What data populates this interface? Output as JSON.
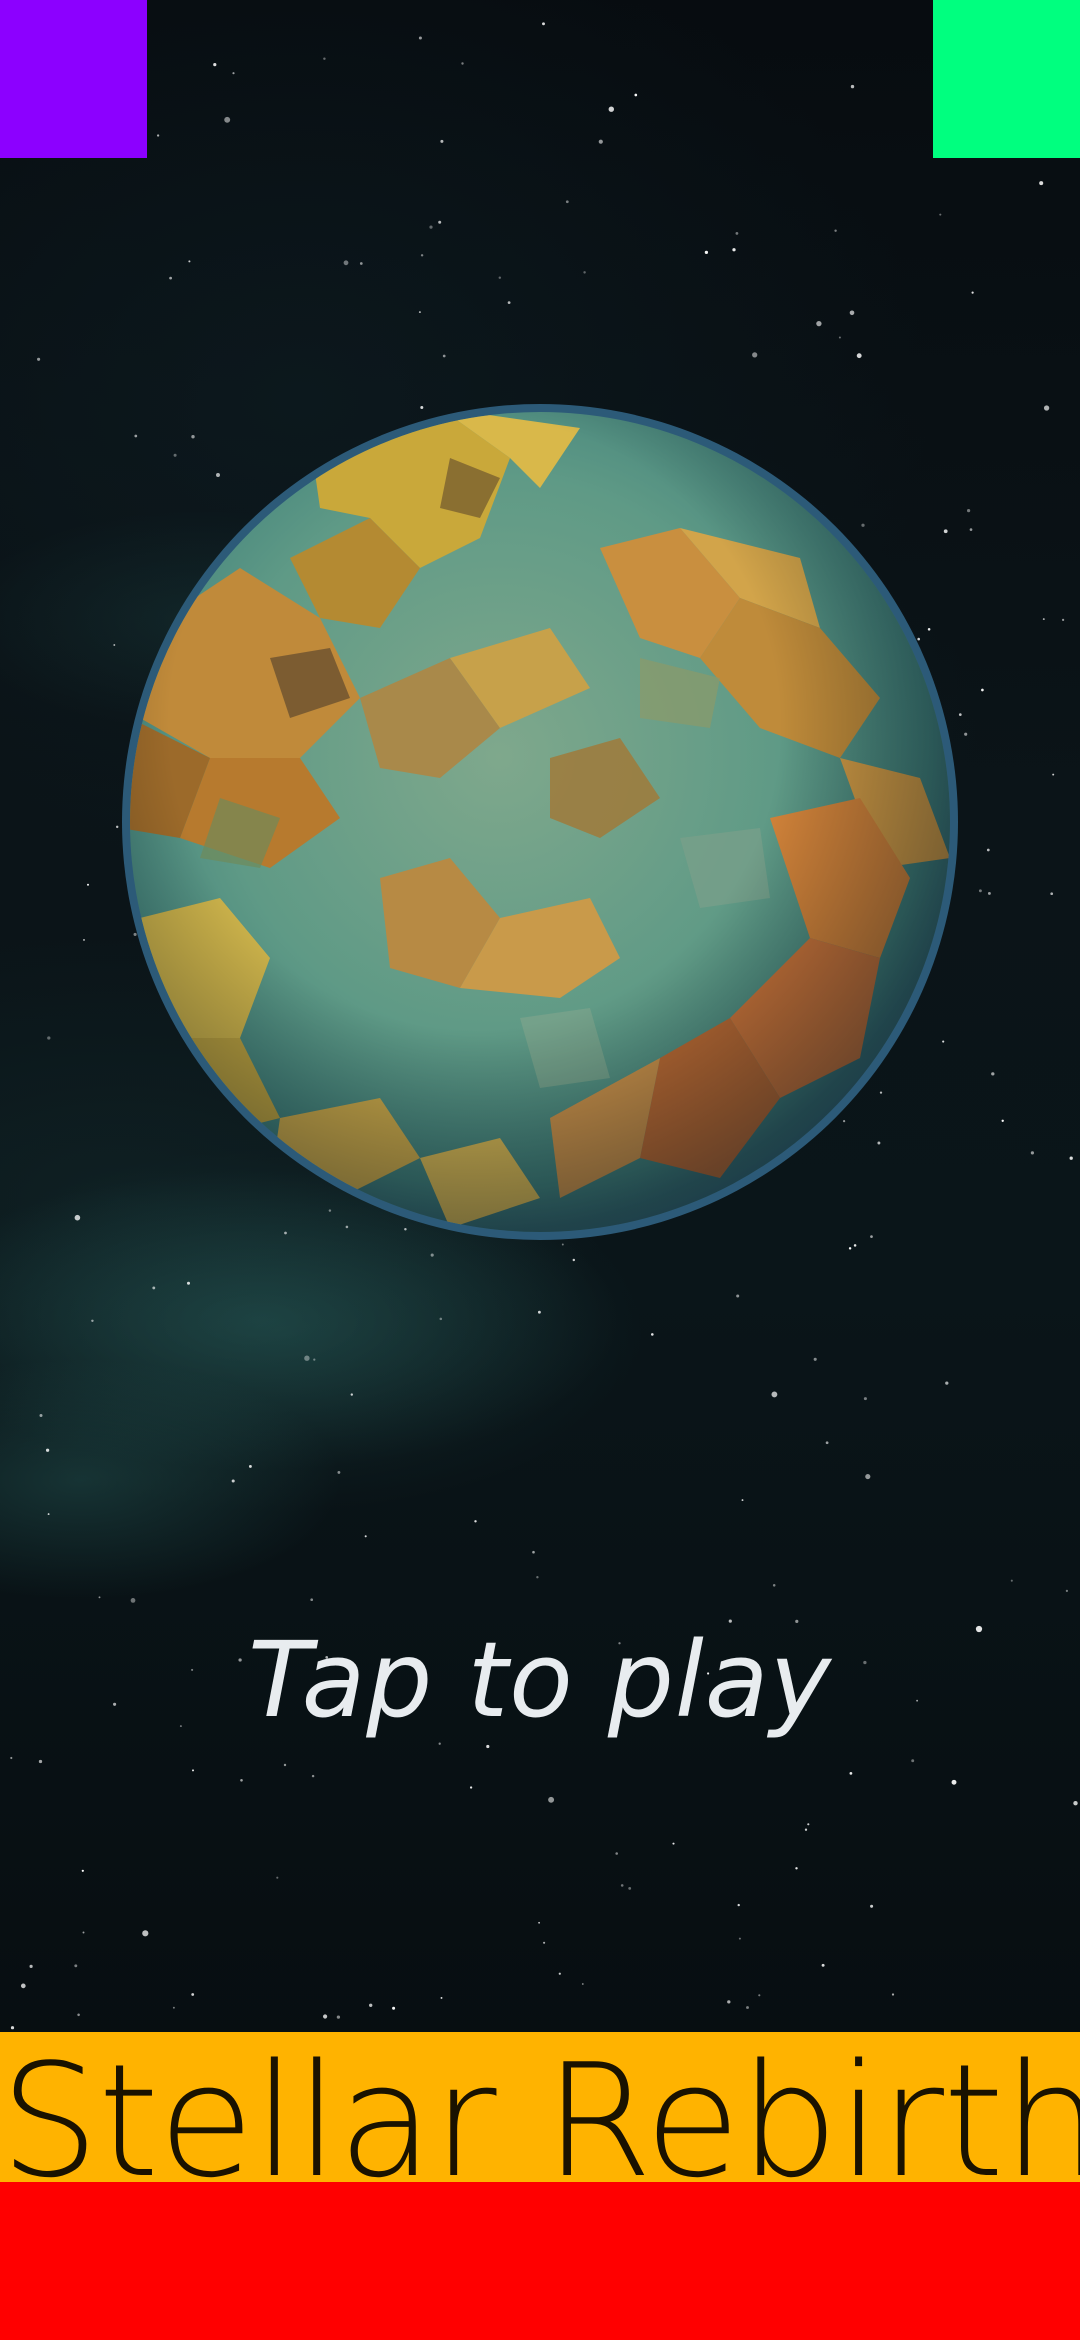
{
  "game": {
    "title": "Stellar Rebirth",
    "tap_prompt": "Tap to play"
  },
  "colors": {
    "corner_left": "#8c00ff",
    "corner_right": "#00ff7f",
    "title_bar": "#ffb300",
    "bottom_bar": "#ff0000"
  },
  "icons": {
    "planet": "low-poly-planet"
  }
}
